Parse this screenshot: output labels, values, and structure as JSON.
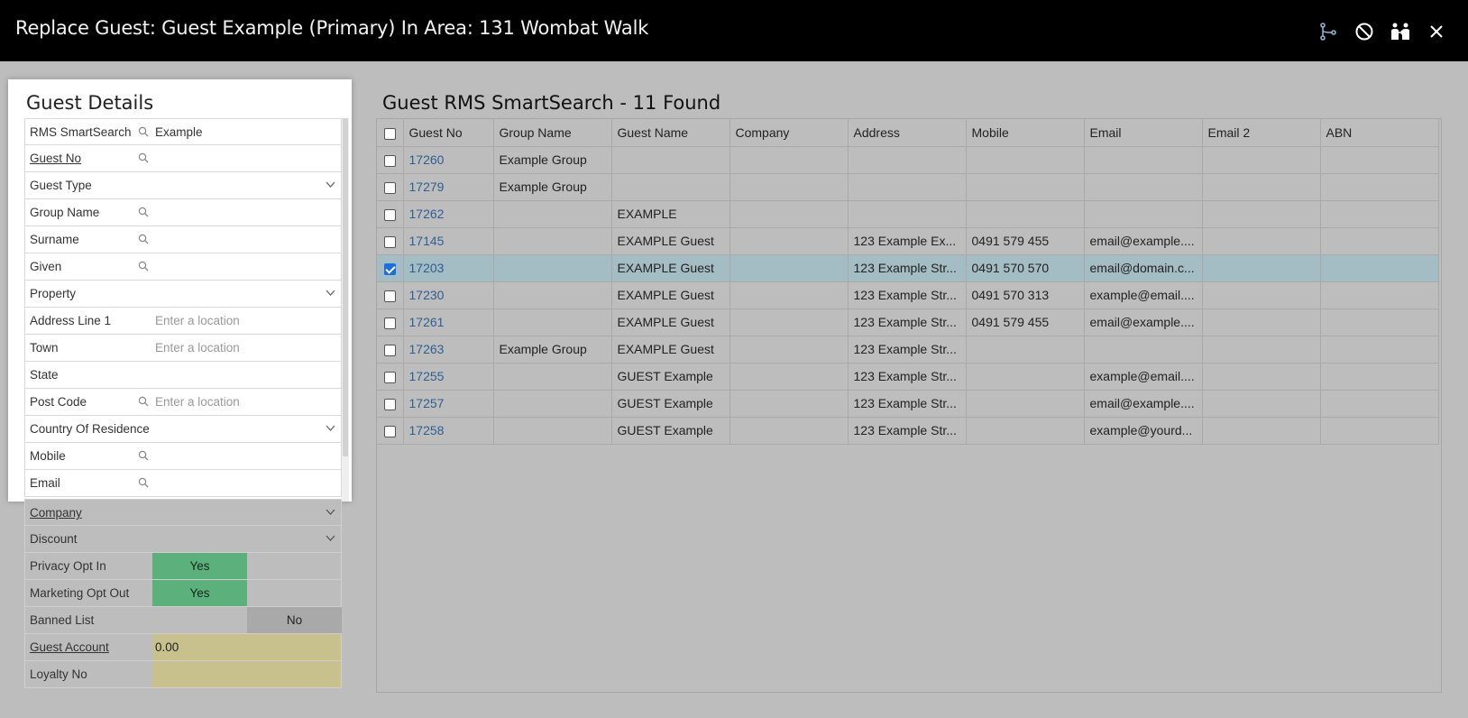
{
  "window": {
    "title": "Replace Guest: Guest Example (Primary) In Area: 131 Wombat Walk"
  },
  "toolbar_icons": [
    "merge-icon",
    "cancel-icon",
    "guests-icon",
    "close-icon"
  ],
  "guest_details": {
    "title": "Guest Details",
    "fields": [
      {
        "label": "RMS SmartSearch",
        "value": "Example",
        "search": true
      },
      {
        "label": "Guest No",
        "value": "",
        "search": true,
        "link": true
      },
      {
        "label": "Guest Type",
        "value": "",
        "dropdown": true
      },
      {
        "label": "Group Name",
        "value": "",
        "search": true
      },
      {
        "label": "Surname",
        "value": "",
        "search": true
      },
      {
        "label": "Given",
        "value": "",
        "search": true
      },
      {
        "label": "Property",
        "value": "",
        "dropdown": true
      },
      {
        "label": "Address Line 1",
        "placeholder": "Enter a location"
      },
      {
        "label": "Town",
        "placeholder": "Enter a location"
      },
      {
        "label": "State",
        "value": ""
      },
      {
        "label": "Post Code",
        "placeholder": "Enter a location",
        "search": true
      },
      {
        "label": "Country Of Residence",
        "value": "",
        "dropdown": true
      },
      {
        "label": "Mobile",
        "value": "",
        "search": true
      },
      {
        "label": "Email",
        "value": "",
        "search": true
      }
    ],
    "extra": {
      "company": "Company",
      "discount": "Discount",
      "privacy_opt_in": "Privacy Opt In",
      "privacy_yes": "Yes",
      "marketing_opt_out": "Marketing Opt Out",
      "marketing_yes": "Yes",
      "banned_list": "Banned List",
      "banned_no": "No",
      "guest_account": "Guest Account",
      "guest_account_value": "0.00",
      "loyalty_no": "Loyalty No"
    }
  },
  "results": {
    "title": "Guest RMS SmartSearch - 11 Found",
    "columns": [
      "Guest No",
      "Group Name",
      "Guest Name",
      "Company",
      "Address",
      "Mobile",
      "Email",
      "Email 2",
      "ABN"
    ],
    "rows": [
      {
        "checked": false,
        "cells": [
          "17260",
          "Example Group",
          "",
          "",
          "",
          "",
          "",
          "",
          ""
        ]
      },
      {
        "checked": false,
        "cells": [
          "17279",
          "Example Group",
          "",
          "",
          "",
          "",
          "",
          "",
          ""
        ]
      },
      {
        "checked": false,
        "cells": [
          "17262",
          "",
          "EXAMPLE",
          "",
          "",
          "",
          "",
          "",
          ""
        ]
      },
      {
        "checked": false,
        "cells": [
          "17145",
          "",
          "EXAMPLE Guest",
          "",
          "123 Example Ex...",
          "0491 579 455",
          "email@example....",
          "",
          ""
        ]
      },
      {
        "checked": true,
        "cells": [
          "17203",
          "",
          "EXAMPLE Guest",
          "",
          "123 Example Str...",
          "0491 570 570",
          "email@domain.c...",
          "",
          ""
        ]
      },
      {
        "checked": false,
        "cells": [
          "17230",
          "",
          "EXAMPLE Guest",
          "",
          "123 Example Str...",
          "0491 570 313",
          "example@email....",
          "",
          ""
        ]
      },
      {
        "checked": false,
        "cells": [
          "17261",
          "",
          "EXAMPLE Guest",
          "",
          "123 Example Str...",
          "0491 579 455",
          "email@example....",
          "",
          ""
        ]
      },
      {
        "checked": false,
        "cells": [
          "17263",
          "Example Group",
          "EXAMPLE Guest",
          "",
          "123 Example Str...",
          "",
          "",
          "",
          ""
        ]
      },
      {
        "checked": false,
        "cells": [
          "17255",
          "",
          "GUEST Example",
          "",
          "123 Example Str...",
          "",
          "example@email....",
          "",
          ""
        ]
      },
      {
        "checked": false,
        "cells": [
          "17257",
          "",
          "GUEST Example",
          "",
          "123 Example Str...",
          "",
          "email@example....",
          "",
          ""
        ]
      },
      {
        "checked": false,
        "cells": [
          "17258",
          "",
          "GUEST Example",
          "",
          "123 Example Str...",
          "",
          "example@yourd...",
          "",
          ""
        ]
      }
    ]
  }
}
